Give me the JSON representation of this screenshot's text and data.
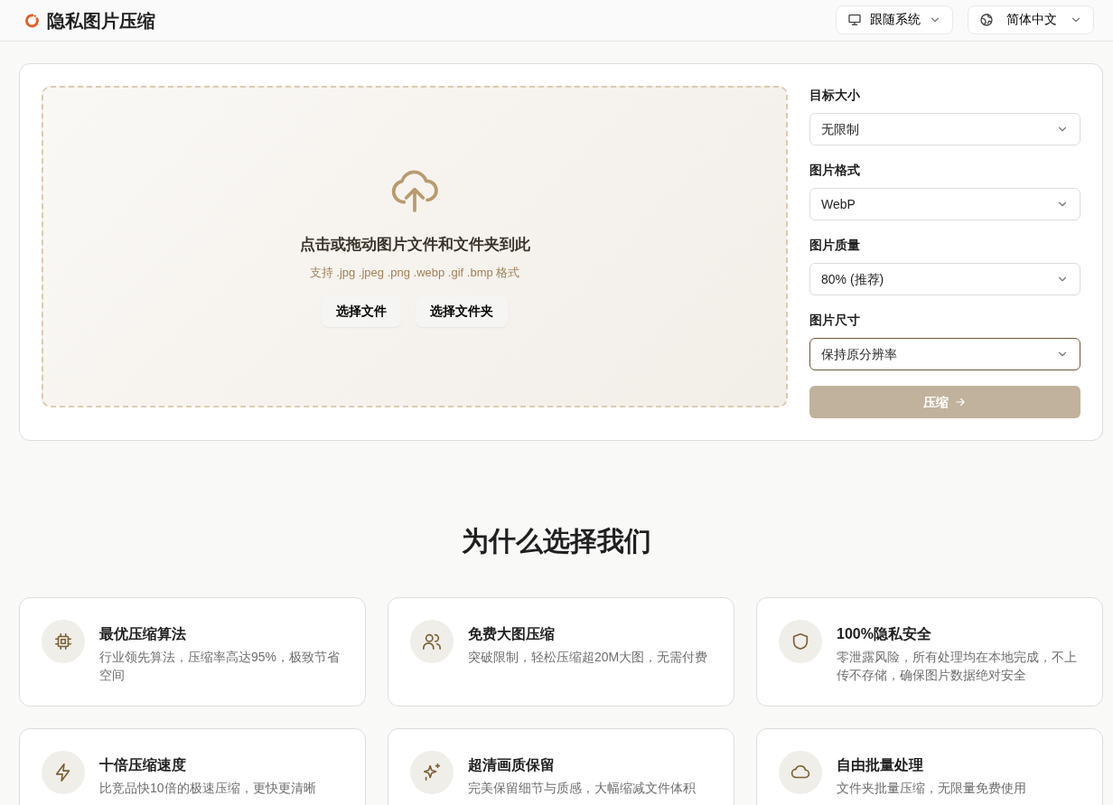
{
  "header": {
    "title": "隐私图片压缩",
    "theme_menu": {
      "label": "跟随系统"
    },
    "language_menu": {
      "label": "简体中文"
    }
  },
  "upload": {
    "heading": "点击或拖动图片文件和文件夹到此",
    "formats": "支持 .jpg .jpeg .png .webp .gif .bmp 格式",
    "buttons": [
      "选择文件",
      "选择文件夹"
    ]
  },
  "settings": [
    {
      "label": "目标大小",
      "value": "无限制",
      "focused": false
    },
    {
      "label": "图片格式",
      "value": "WebP",
      "focused": false
    },
    {
      "label": "图片质量",
      "value": "80% (推荐)",
      "focused": false
    },
    {
      "label": "图片尺寸",
      "value": "保持原分辨率",
      "focused": true
    }
  ],
  "compress_button": {
    "label": "压缩",
    "disabled": true
  },
  "features_heading": "为什么选择我们",
  "features": [
    {
      "title": "最优压缩算法",
      "text": "行业领先算法，压缩率高达95%，极致节省空间"
    },
    {
      "title": "免费大图压缩",
      "text": "突破限制，轻松压缩超20M大图，无需付费"
    },
    {
      "title": "100%隐私安全",
      "text": "零泄露风险，所有处理均在本地完成，不上传不存储，确保图片数据绝对安全"
    },
    {
      "title": "十倍压缩速度",
      "text": "比竞品快10倍的极速压缩，更快更清晰"
    },
    {
      "title": "超清画质保留",
      "text": "完美保留细节与质感，大幅缩减文件体积"
    },
    {
      "title": "自由批量处理",
      "text": "文件夹批量压缩，无限量免费使用"
    }
  ]
}
